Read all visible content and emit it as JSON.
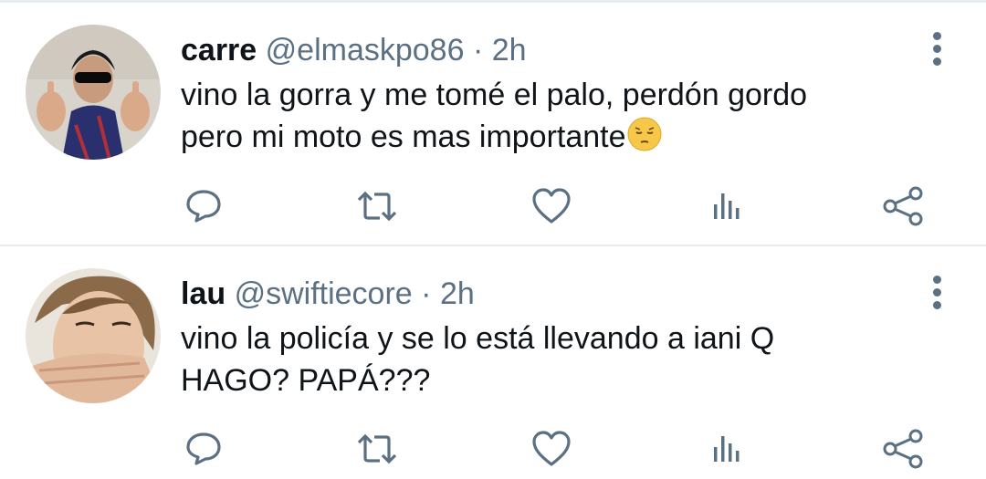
{
  "tweets": [
    {
      "name": "carre",
      "handle": "@elmaskpo86",
      "separator": "·",
      "time": "2h",
      "text_line1": "vino la gorra y me tomé el palo, perdón gordo",
      "text_line2": "pero mi moto es mas importante",
      "emoji": "pensive-face-emoji"
    },
    {
      "name": "lau",
      "handle": "@swiftiecore",
      "separator": "·",
      "time": "2h",
      "text_line1": "vino la policía y se lo está llevando a iani Q",
      "text_line2": "HAGO? PAPÁ???"
    }
  ],
  "icons": {
    "reply": "comment-icon",
    "retweet": "retweet-icon",
    "like": "heart-icon",
    "analytics": "analytics-icon",
    "share": "share-icon",
    "more": "more-vertical-icon"
  },
  "colors": {
    "icon": "#5b7083",
    "text": "#0f1419",
    "muted": "#5b7083",
    "divider": "#e6ecf0"
  }
}
